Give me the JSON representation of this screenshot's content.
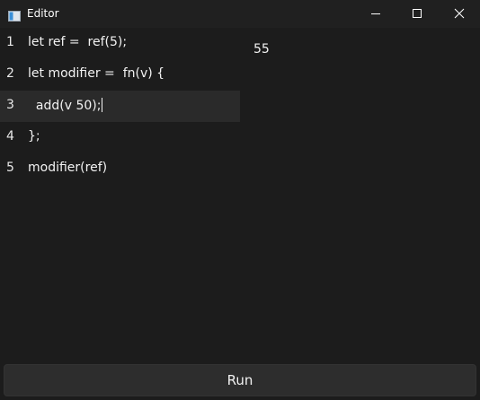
{
  "window": {
    "title": "Editor",
    "icons": [
      "app-icon",
      "minimize-icon",
      "maximize-icon",
      "close-icon"
    ]
  },
  "editor": {
    "current_line": 3,
    "lines": [
      {
        "number": "1",
        "text": "let ref =  ref(5);"
      },
      {
        "number": "2",
        "text": "let modifier =  fn(v) {"
      },
      {
        "number": "3",
        "text": "  add(v 50);"
      },
      {
        "number": "4",
        "text": "};"
      },
      {
        "number": "5",
        "text": "modifier(ref)"
      }
    ]
  },
  "output": {
    "value": "55"
  },
  "run_button": {
    "label": "Run"
  },
  "colors": {
    "background": "#1c1c1c",
    "titlebar": "#202020",
    "current_line_highlight": "#2a2a2a",
    "button": "#2d2d2d",
    "text": "#f2f2f2"
  }
}
